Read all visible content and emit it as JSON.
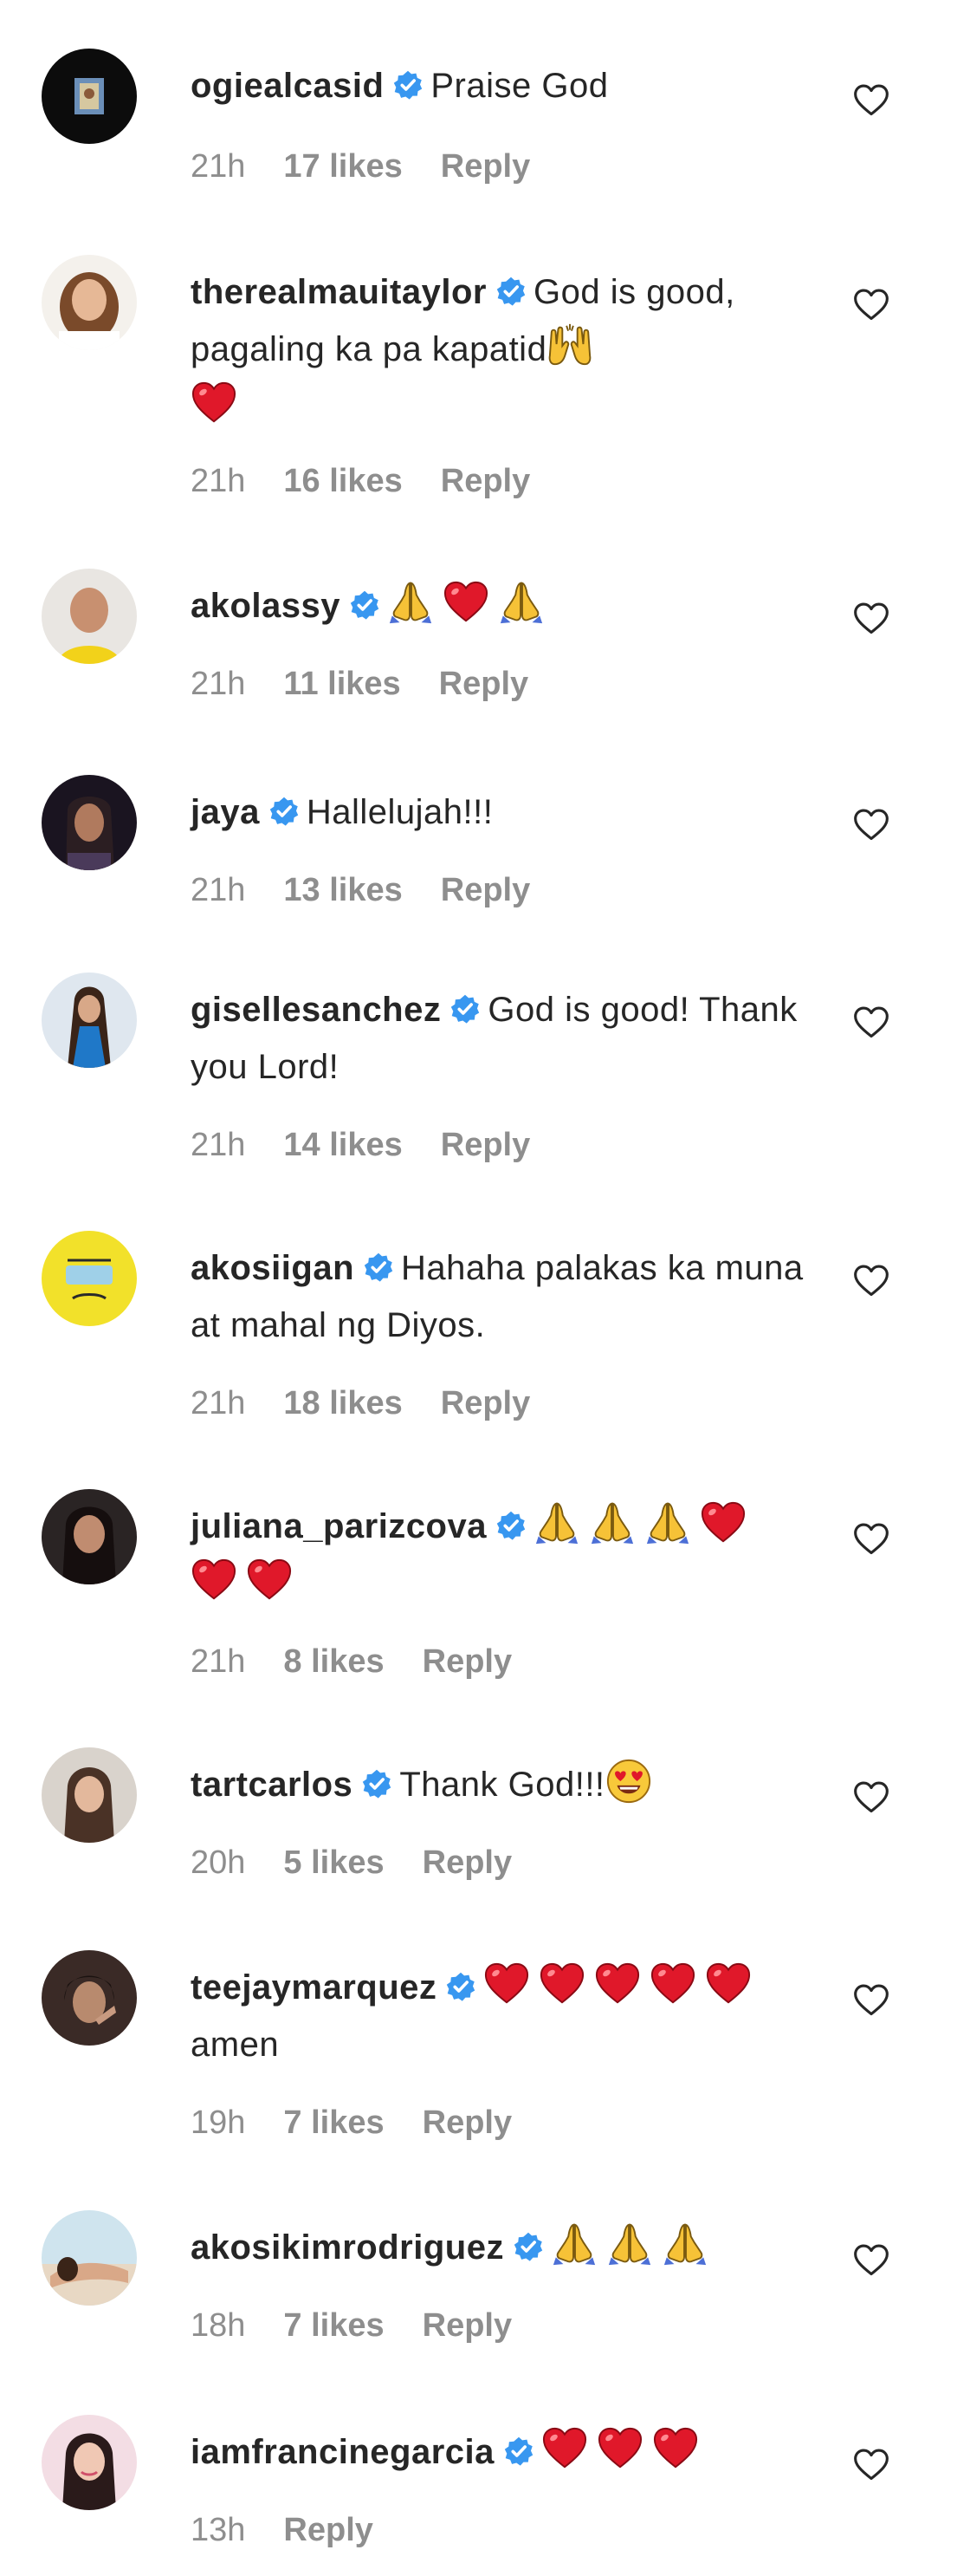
{
  "colors": {
    "text": "#262626",
    "meta": "#8e8e8e",
    "verified_badge": "#3897f0",
    "heart_red": "#e0182a",
    "pray_yellow": "#f6c237"
  },
  "comments": [
    {
      "username": "ogiealcasid",
      "text": "Praise God",
      "time": "21h",
      "likes": "17 likes",
      "reply": "Reply"
    },
    {
      "username": "therealmauitaylor",
      "text": "God is good, pagaling ka pa kapatid",
      "emojis": "raised-hands, red-heart",
      "time": "21h",
      "likes": "16 likes",
      "reply": "Reply"
    },
    {
      "username": "akolassy",
      "text": "",
      "emojis": "folded-hands, red-heart, folded-hands",
      "time": "21h",
      "likes": "11 likes",
      "reply": "Reply"
    },
    {
      "username": "jaya",
      "text": "Hallelujah!!!",
      "time": "21h",
      "likes": "13 likes",
      "reply": "Reply"
    },
    {
      "username": "gisellesanchez",
      "text": "God is good! Thank you Lord!",
      "time": "21h",
      "likes": "14 likes",
      "reply": "Reply"
    },
    {
      "username": "akosiigan",
      "text": "Hahaha palakas ka muna at mahal ng Diyos.",
      "time": "21h",
      "likes": "18 likes",
      "reply": "Reply"
    },
    {
      "username": "juliana_parizcova",
      "text": "",
      "emojis": "folded-hands x3, red-heart x3",
      "time": "21h",
      "likes": "8 likes",
      "reply": "Reply"
    },
    {
      "username": "tartcarlos",
      "text": "Thank God!!!",
      "emojis": "heart-eyes",
      "time": "20h",
      "likes": "5 likes",
      "reply": "Reply"
    },
    {
      "username": "teejaymarquez",
      "text": "amen",
      "emojis": "red-heart x5",
      "time": "19h",
      "likes": "7 likes",
      "reply": "Reply"
    },
    {
      "username": "akosikimrodriguez",
      "text": "",
      "emojis": "folded-hands x3",
      "time": "18h",
      "likes": "7 likes",
      "reply": "Reply"
    },
    {
      "username": "iamfrancinegarcia",
      "text": "",
      "emojis": "red-heart x3",
      "time": "13h",
      "likes": "",
      "reply": "Reply"
    }
  ]
}
